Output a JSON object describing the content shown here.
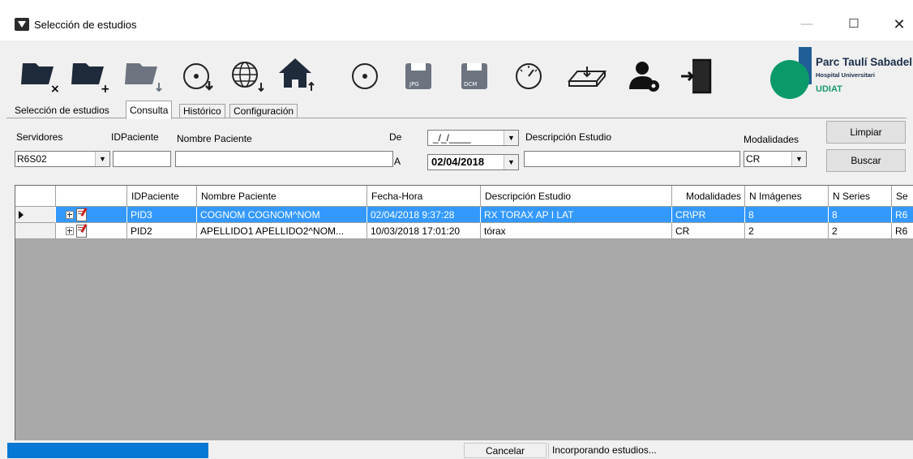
{
  "window": {
    "title": "Selección de estudios",
    "min": "—",
    "max": "☐",
    "close": "✕"
  },
  "logo": {
    "title": "Parc Taulí Sabadell",
    "subtitle": "Hospital Universitari",
    "unit": "UDIAT"
  },
  "tabs": [
    {
      "label": "Selección de estudios",
      "active": false
    },
    {
      "label": "Consulta",
      "active": true
    },
    {
      "label": "Histórico",
      "active": false
    },
    {
      "label": "Configuración",
      "active": false
    }
  ],
  "filters": {
    "servidores_label": "Servidores",
    "servidores_value": "R6S02",
    "idpaciente_label": "IDPaciente",
    "nombre_label": "Nombre Paciente",
    "de_label": "De",
    "de_value": "_/_/____",
    "a_label": "A",
    "a_value": "02/04/2018",
    "descripcion_label": "Descripción Estudio",
    "modalidades_label": "Modalidades",
    "modalidades_value": "CR",
    "limpiar_label": "Limpiar",
    "buscar_label": "Buscar"
  },
  "grid": {
    "columns": [
      "IDPaciente",
      "Nombre Paciente",
      "Fecha-Hora",
      "Descripción Estudio",
      "Modalidades",
      "N Imágenes",
      "N Series",
      "Se"
    ],
    "rows": [
      {
        "id": "PID3",
        "nombre": "COGNOM COGNOM^NOM",
        "fecha": "02/04/2018 9:37:28",
        "descripcion": "RX TORAX AP I LAT",
        "modalidades": "CR\\PR",
        "imagenes": "8",
        "series": "8",
        "se": "R6",
        "selected": true
      },
      {
        "id": "PID2",
        "nombre": "APELLIDO1 APELLIDO2^NOM...",
        "fecha": "10/03/2018 17:01:20",
        "descripcion": "tórax",
        "modalidades": "CR",
        "imagenes": "2",
        "series": "2",
        "se": "R6",
        "selected": false
      }
    ]
  },
  "status": {
    "cancel_label": "Cancelar",
    "message": "Incorporando estudios...",
    "progress": 0.22
  }
}
